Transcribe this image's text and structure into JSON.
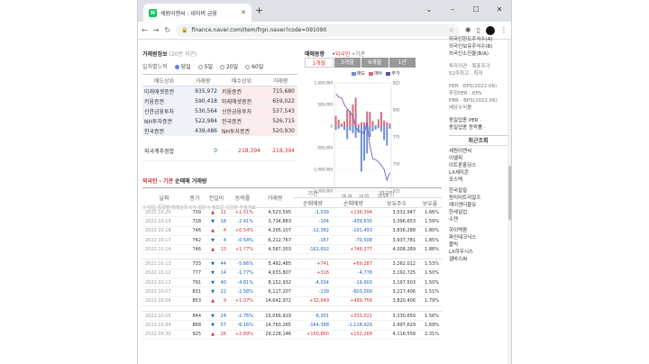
{
  "browser": {
    "tab_title": "세원이앤씨 : 네이버 금융",
    "url": "finance.naver.com/item/frgn.naver?code=091090",
    "window_controls": [
      "⌄",
      "–",
      "☐",
      "✕"
    ]
  },
  "trade_info": {
    "title": "거래원정보",
    "subtitle": "(20분 지연)",
    "period_label": "일자별누적",
    "periods": [
      {
        "label": "당일",
        "selected": true
      },
      {
        "label": "5일",
        "selected": false
      },
      {
        "label": "20일",
        "selected": false
      },
      {
        "label": "60일",
        "selected": false
      }
    ],
    "headers": [
      "매도상위",
      "거래량",
      "매수상위",
      "거래량"
    ],
    "rows": [
      [
        "미래에셋증권",
        "935,972",
        "키움증권",
        "715,680"
      ],
      [
        "키움증권",
        "590,418",
        "미래에셋증권",
        "659,022"
      ],
      [
        "신한금융투자",
        "530,564",
        "신한금융투자",
        "537,543"
      ],
      [
        "NH투자증권",
        "522,984",
        "한국증권",
        "526,715"
      ],
      [
        "한국증권",
        "439,486",
        "NH투자증권",
        "520,930"
      ]
    ],
    "foreign_label": "외국계추정합",
    "foreign_sell": "0",
    "foreign_buy": "218,394",
    "foreign_net": "218,394",
    "note": "※ 당일 종목별 매매상위 5개 회원사 정보를 이용한 추정자료"
  },
  "chart": {
    "title": "매매동향",
    "filter_foreign": "외국인",
    "filter_inst": "기관",
    "tabs": [
      {
        "label": "1개월",
        "active": true
      },
      {
        "label": "3개월",
        "active": false
      },
      {
        "label": "6개월",
        "active": false
      },
      {
        "label": "1년",
        "active": false
      }
    ],
    "legend": [
      {
        "label": "매도",
        "color": "#6b8fd6"
      },
      {
        "label": "매수",
        "color": "#d46a7e"
      },
      {
        "label": "주가",
        "color": "#5b4bb7"
      }
    ],
    "colors": {
      "buy": "#d46a7e",
      "sell": "#6b8fd6",
      "line": "#5b4bb7"
    }
  },
  "chart_data": {
    "type": "bar",
    "title": "",
    "y_left_ticks": [
      "1,000,000",
      "500,000",
      "0",
      "-500,000",
      "-1,000,000",
      "-1,500,000"
    ],
    "y_right_ticks": [
      "825",
      "800",
      "775",
      "750",
      "725"
    ],
    "x_ticks": [
      "09.28",
      "10.05",
      "10.14"
    ],
    "ylim": [
      -1500000,
      1000000
    ],
    "y2lim": [
      725,
      825
    ],
    "series": [
      {
        "name": "매수",
        "values": [
          240000,
          150000,
          60000,
          110000,
          380000,
          350000,
          500000,
          660000,
          40000,
          90000,
          90000,
          340000,
          330000,
          120000,
          20000,
          160000,
          330000,
          130000,
          90000,
          60000
        ]
      },
      {
        "name": "매도",
        "values": [
          -90000,
          -60000,
          -20000,
          -90000,
          -300000,
          -100000,
          -160000,
          -270000,
          -150000,
          -1050000,
          -800000,
          -630000,
          -250000,
          -120000,
          -80000,
          -50000,
          -120000,
          -320000,
          -450000,
          -60000
        ]
      },
      {
        "name": "주가",
        "values": [
          815,
          812,
          811,
          805,
          801,
          798,
          794,
          784,
          780,
          780,
          778,
          789,
          767,
          755,
          754,
          752,
          749,
          745,
          735,
          742
        ]
      }
    ]
  },
  "net_trade": {
    "title_foreign": "외국인",
    "title_inst": "기관",
    "title_suffix": "순매매 거래량",
    "headers_top": [
      "기관",
      "외국인"
    ],
    "headers": [
      "날짜",
      "종가",
      "전일비",
      "등락률",
      "거래량",
      "순매매량",
      "순매매량",
      "보유주수",
      "보유율"
    ],
    "rows": [
      [
        "2022.10.20",
        "739",
        "▲",
        "11",
        "+1.51%",
        "4,523,595",
        "-1,039",
        "+136,394",
        "3,532,947",
        "1.66%",
        "up"
      ],
      [
        "2022.10.19",
        "728",
        "▼",
        "18",
        "-2.41%",
        "3,734,883",
        "-104",
        "-439,635",
        "3,396,653",
        "1.59%",
        "down"
      ],
      [
        "2022.10.18",
        "746",
        "▲",
        "4",
        "+0.54%",
        "4,295,107",
        "-12,382",
        "-101,493",
        "3,836,288",
        "1.80%",
        "up"
      ],
      [
        "2022.10.17",
        "742",
        "▼",
        "4",
        "-0.54%",
        "6,212,767",
        "-167",
        "-70,508",
        "3,937,781",
        "1.85%",
        "down"
      ],
      [
        "2022.10.14",
        "746",
        "▲",
        "13",
        "+1.77%",
        "4,587,303",
        "-162,602",
        "+746,277",
        "4,008,289",
        "1.88%",
        "up"
      ],
      "gap",
      [
        "2022.10.13",
        "733",
        "▼",
        "44",
        "-5.66%",
        "5,492,485",
        "+741",
        "+69,287",
        "3,262,012",
        "1.53%",
        "down"
      ],
      [
        "2022.10.12",
        "777",
        "▼",
        "14",
        "-1.77%",
        "4,633,807",
        "+316",
        "-4,778",
        "3,192,725",
        "1.50%",
        "down"
      ],
      [
        "2022.10.11",
        "791",
        "▼",
        "40",
        "-4.81%",
        "8,152,932",
        "-4,034",
        "-19,903",
        "3,197,503",
        "1.50%",
        "down"
      ],
      [
        "2022.10.07",
        "831",
        "▼",
        "22",
        "-2.58%",
        "6,117,207",
        "-139",
        "-603,000",
        "3,217,406",
        "1.51%",
        "down"
      ],
      [
        "2022.10.06",
        "853",
        "▲",
        "9",
        "+1.07%",
        "14,642,972",
        "+32,649",
        "+489,756",
        "3,820,406",
        "1.79%",
        "up"
      ],
      "gap",
      [
        "2022.10.05",
        "844",
        "▼",
        "24",
        "-2.76%",
        "15,056,919",
        "-6,301",
        "+333,021",
        "3,330,650",
        "1.56%",
        "down"
      ],
      [
        "2022.10.04",
        "868",
        "▼",
        "57",
        "-6.16%",
        "14,760,265",
        "-164,388",
        "-1,118,929",
        "2,997,629",
        "1.69%",
        "down"
      ],
      [
        "2022.09.30",
        "925",
        "▲",
        "26",
        "+2.89%",
        "29,228,146",
        "+150,860",
        "+152,269",
        "4,116,558",
        "2.31%",
        "up"
      ]
    ]
  },
  "right_panel": {
    "top_items": [
      "외국인한도주식수(A)",
      "외국인보유주식수(B)",
      "외국인소진율(B/A)"
    ],
    "mid_items": [
      "투자의견 · 목표주가",
      "52주최고 · 최저"
    ],
    "per_items": [
      "PER · EPS(2022.06)",
      "추정PER · EPS",
      "PBR · BPS(2022.06)",
      "배당수익률"
    ],
    "industry_items": [
      "동일업종 PER ·",
      "동일업종 등락률 ·"
    ],
    "recent_title": "최근조회",
    "recent": [
      "세원이앤씨",
      "이엘피",
      "이트론홀딩스",
      "LX세미콘",
      "포스텍",
      "",
      "한국칼칼",
      "원익머트리얼즈",
      "케이엔더블유",
      "한세실업",
      "수젠",
      "",
      "하이텍팜",
      "파인테크닉스",
      "플릭",
      "LX하우시스",
      "셀바스AI"
    ]
  }
}
